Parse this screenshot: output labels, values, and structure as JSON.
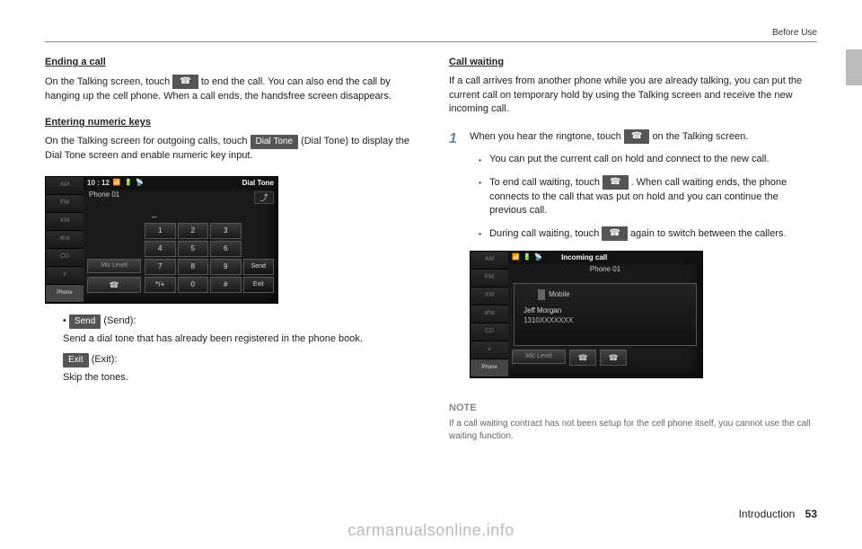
{
  "header": {
    "chapter": "Before Use"
  },
  "left": {
    "sec1": {
      "title": "Ending a call",
      "p1a": "On the Talking screen, touch ",
      "p1b": " to end the call. You can also end the call by hanging up the cell phone. When a call ends, the handsfree screen disappears."
    },
    "sec2": {
      "title": "Entering numeric keys",
      "p1a": "On the Talking screen for outgoing calls, touch ",
      "btn_dialtone": "Dial Tone",
      "p1b": " (Dial Tone) to display the Dial Tone screen and enable numeric key input."
    },
    "defs": {
      "send_btn": "Send",
      "send_label": " (Send):",
      "send_desc": "Send a dial tone that has already been registered in the phone book.",
      "exit_btn": "Exit",
      "exit_label": " (Exit):",
      "exit_desc": "Skip the tones."
    }
  },
  "right": {
    "sec1": {
      "title": "Call waiting",
      "p1": "If a call arrives from another phone while you are already talking, you can put the current call on temporary hold by using the Talking screen and receive the new incoming call."
    },
    "step": {
      "num": "1",
      "text_a": "When you hear the ringtone, touch ",
      "text_b": " on the Talking screen.",
      "b1": "You can put the current call on hold and connect to the new call.",
      "b2a": "To end call waiting, touch ",
      "b2b": ". When call waiting ends, the phone connects to the call that was put on hold and you can continue the previous call.",
      "b3a": "During call waiting, touch ",
      "b3b": " again to switch between the callers."
    },
    "note": {
      "label": "NOTE",
      "text": "If a call waiting contract has not been setup for the cell phone itself, you cannot use the call waiting function."
    }
  },
  "device1": {
    "time": "10 : 12",
    "title": "Dial Tone",
    "phone": "Phone 01",
    "mic": "Mic Level",
    "side": {
      "am": "AM",
      "fm": "FM",
      "xm": "XM",
      "aha": "aha",
      "cd": "CD",
      "v": "∨",
      "phone": "Phone"
    },
    "keys": {
      "dash": "_",
      "k1": "1",
      "k2": "2",
      "k3": "3",
      "k4": "4",
      "k5": "5",
      "k6": "6",
      "k7": "7",
      "k8": "8",
      "k9": "9",
      "send": "Send",
      "kstar": "*/+",
      "k0": "0",
      "khash": "#",
      "exit": "Exit"
    }
  },
  "device2": {
    "title": "Incoming call",
    "phone": "Phone 01",
    "mobile": "Mobile",
    "caller": "Jeff Morgan",
    "number": "1310XXXXXXX",
    "mic": "Mic Level",
    "side": {
      "am": "AM",
      "fm": "FM",
      "xm": "XM",
      "aha": "aha",
      "cd": "CD",
      "v": "∨",
      "phone": "Phone"
    }
  },
  "footer": {
    "section": "Introduction",
    "page": "53"
  },
  "watermark": "carmanualsonline.info",
  "icons": {
    "phone_hangup": "☎"
  }
}
